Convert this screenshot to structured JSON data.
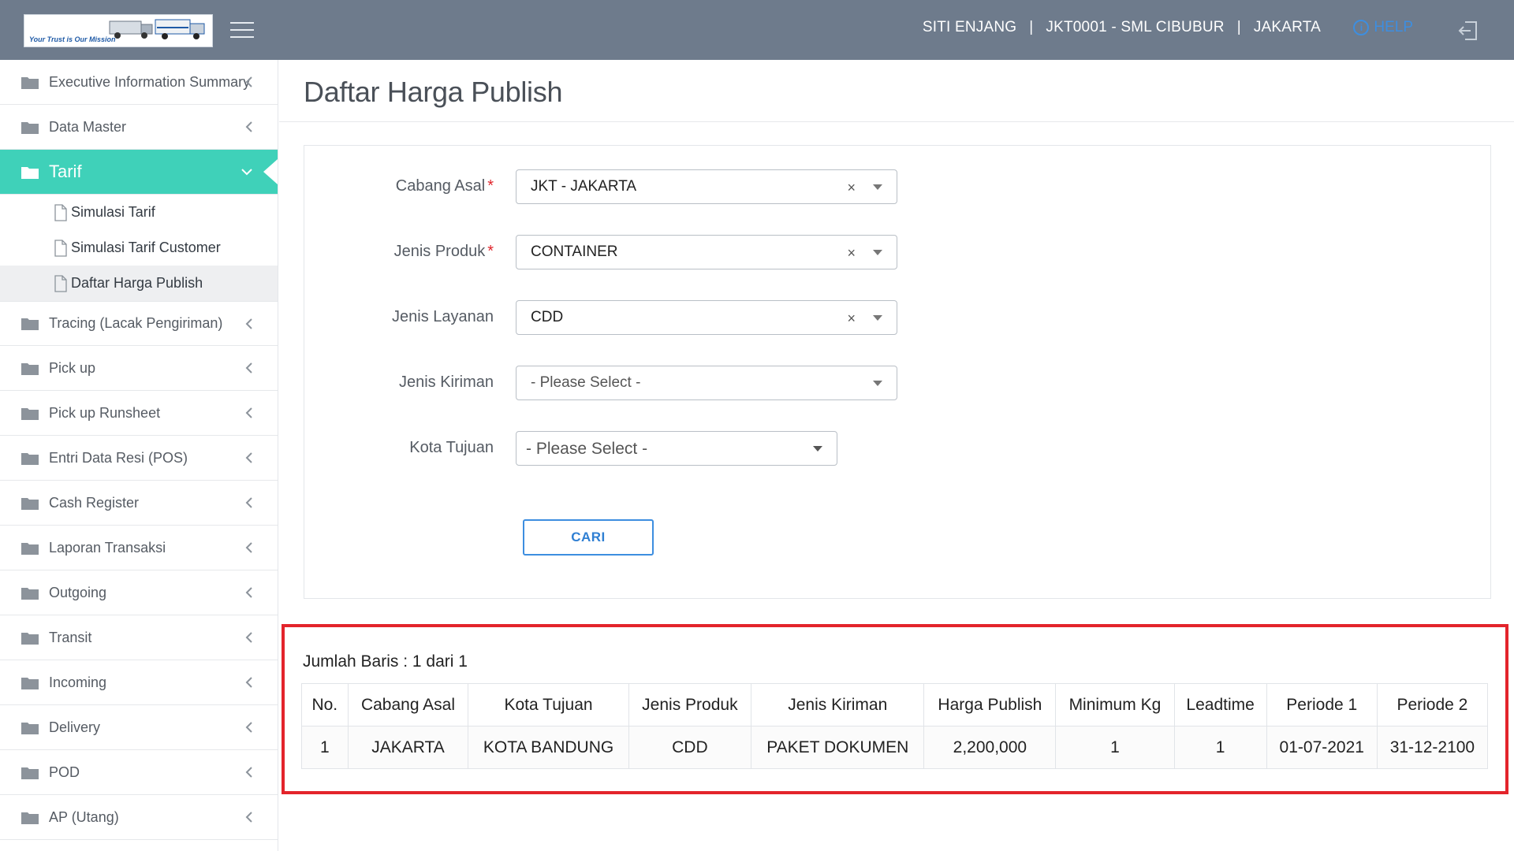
{
  "header": {
    "logo_tagline": "Your Trust is Our Mission",
    "user_name": "SITI ENJANG",
    "branch": "JKT0001 - SML CIBUBUR",
    "city": "JAKARTA",
    "separator": "|",
    "help_label": "HELP"
  },
  "sidebar": {
    "items": [
      {
        "label": "Executive Information Summary"
      },
      {
        "label": "Data Master"
      },
      {
        "label": "Tarif"
      },
      {
        "label": "Tracing (Lacak Pengiriman)"
      },
      {
        "label": "Pick up"
      },
      {
        "label": "Pick up Runsheet"
      },
      {
        "label": "Entri Data Resi (POS)"
      },
      {
        "label": "Cash Register"
      },
      {
        "label": "Laporan Transaksi"
      },
      {
        "label": "Outgoing"
      },
      {
        "label": "Transit"
      },
      {
        "label": "Incoming"
      },
      {
        "label": "Delivery"
      },
      {
        "label": "POD"
      },
      {
        "label": "AP (Utang)"
      }
    ],
    "tarif_subitems": [
      {
        "label": "Simulasi Tarif"
      },
      {
        "label": "Simulasi Tarif Customer"
      },
      {
        "label": "Daftar Harga Publish"
      }
    ]
  },
  "main": {
    "title": "Daftar Harga Publish",
    "form": {
      "required_mark": "*",
      "cabang_asal": {
        "label": "Cabang Asal",
        "value": "JKT - JAKARTA"
      },
      "jenis_produk": {
        "label": "Jenis Produk",
        "value": "CONTAINER"
      },
      "jenis_layanan": {
        "label": "Jenis Layanan",
        "value": "CDD"
      },
      "jenis_kiriman": {
        "label": "Jenis Kiriman",
        "value": "- Please Select -"
      },
      "kota_tujuan": {
        "label": "Kota Tujuan",
        "value": "- Please Select -"
      },
      "clear_symbol": "×",
      "search_button": "CARI"
    },
    "results": {
      "row_count": "Jumlah Baris : 1 dari 1",
      "columns": [
        "No.",
        "Cabang Asal",
        "Kota Tujuan",
        "Jenis Produk",
        "Jenis Kiriman",
        "Harga Publish",
        "Minimum Kg",
        "Leadtime",
        "Periode 1",
        "Periode 2"
      ],
      "rows": [
        [
          "1",
          "JAKARTA",
          "KOTA BANDUNG",
          "CDD",
          "PAKET DOKUMEN",
          "2,200,000",
          "1",
          "1",
          "01-07-2021",
          "31-12-2100"
        ]
      ]
    }
  },
  "colors": {
    "topbar": "#6e7b8c",
    "active_menu": "#3fd1b9",
    "accent_blue": "#3d8ee0",
    "highlight_red": "#e3242b"
  }
}
